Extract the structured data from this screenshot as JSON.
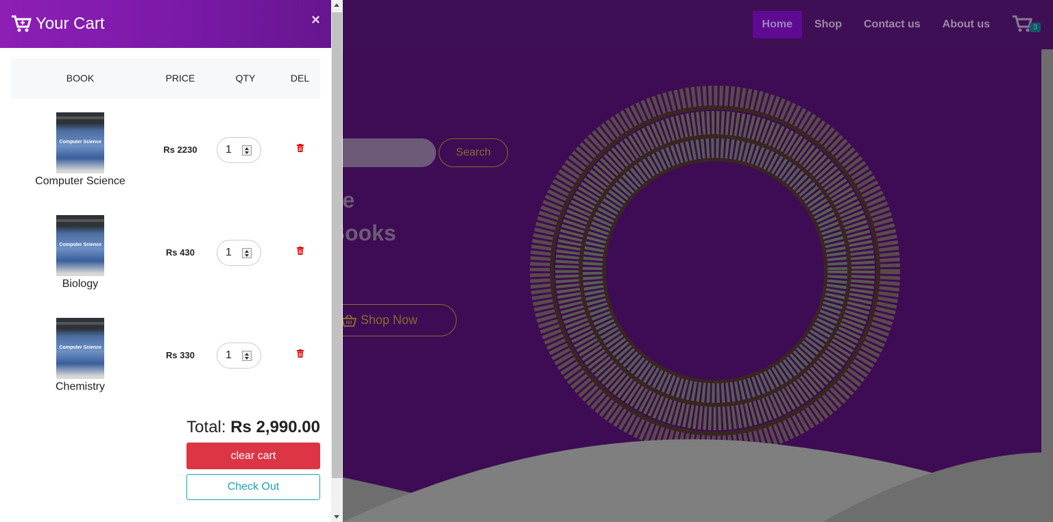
{
  "nav": {
    "links": [
      "Home",
      "Shop",
      "Contact us",
      "About us"
    ],
    "cart_count": "3"
  },
  "hero": {
    "search_button": "Search",
    "line1": "ge",
    "line2": "Books",
    "shop_now": "Shop Now"
  },
  "cart": {
    "title": "Your Cart",
    "close": "×",
    "headers": {
      "book": "BOOK",
      "price": "PRICE",
      "qty": "QTY",
      "del": "DEL"
    },
    "items": [
      {
        "name": "Computer Science",
        "price": "Rs 2230",
        "qty": "1"
      },
      {
        "name": "Biology",
        "price": "Rs 430",
        "qty": "1"
      },
      {
        "name": "Chemistry",
        "price": "Rs 330",
        "qty": "1"
      }
    ],
    "total_label": "Total:",
    "total_value": "Rs 2,990.00",
    "clear_label": "clear cart",
    "checkout_label": "Check Out",
    "cover_title": "Computer Science"
  },
  "colors": {
    "header_gradient_start": "#8d1fb6",
    "header_gradient_end": "#66168e",
    "clear_button": "#dc3545",
    "checkout_border": "#17a2b8",
    "delete_icon": "#e00000",
    "background_page": "#3e0c55"
  }
}
